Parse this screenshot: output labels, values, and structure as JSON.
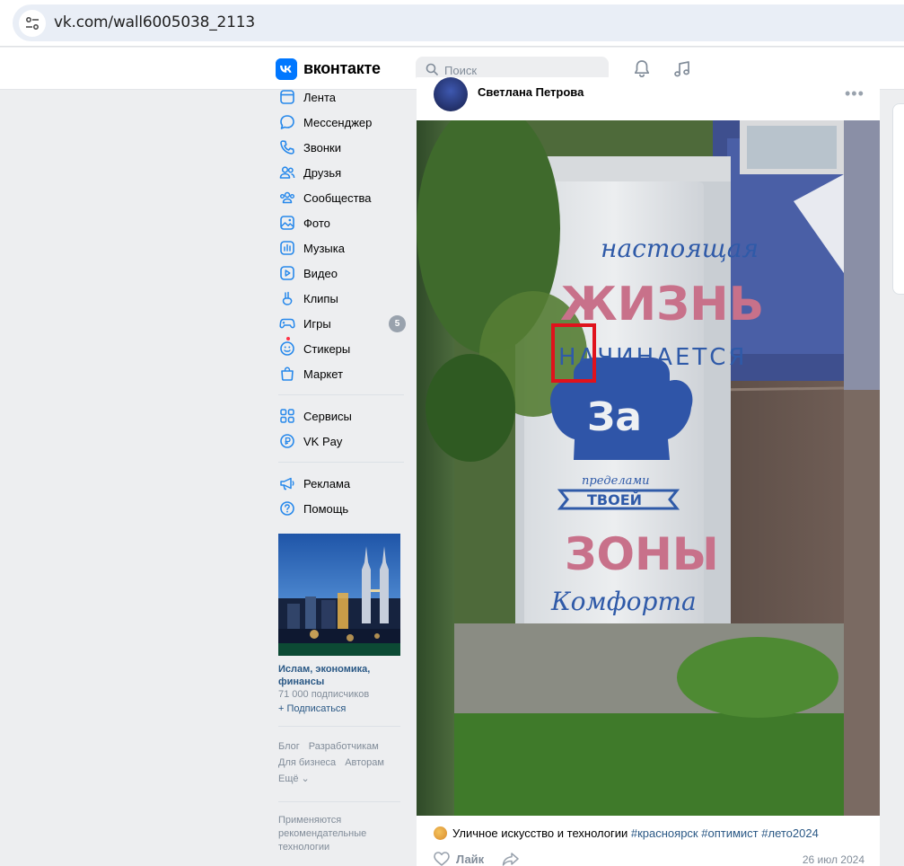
{
  "browser": {
    "url": "vk.com/wall6005038_2113"
  },
  "header": {
    "logo_letter": "К",
    "wordmark": "вконтакте",
    "search_placeholder": "Поиск"
  },
  "menu": {
    "items": [
      {
        "label": "Лента",
        "icon": "news-icon"
      },
      {
        "label": "Мессенджер",
        "icon": "messenger-icon"
      },
      {
        "label": "Звонки",
        "icon": "phone-icon"
      },
      {
        "label": "Друзья",
        "icon": "friends-icon"
      },
      {
        "label": "Сообщества",
        "icon": "communities-icon"
      },
      {
        "label": "Фото",
        "icon": "photo-icon"
      },
      {
        "label": "Музыка",
        "icon": "music-icon"
      },
      {
        "label": "Видео",
        "icon": "video-icon"
      },
      {
        "label": "Клипы",
        "icon": "clips-icon"
      },
      {
        "label": "Игры",
        "icon": "games-icon",
        "badge": "5"
      },
      {
        "label": "Стикеры",
        "icon": "stickers-icon"
      },
      {
        "label": "Маркет",
        "icon": "market-icon"
      }
    ],
    "services": [
      {
        "label": "Сервисы",
        "icon": "services-icon"
      },
      {
        "label": "VK Pay",
        "icon": "vkpay-icon"
      }
    ],
    "help": [
      {
        "label": "Реклама",
        "icon": "ads-icon"
      },
      {
        "label": "Помощь",
        "icon": "help-icon"
      }
    ]
  },
  "promo": {
    "title": "Ислам, экономика, финансы",
    "subscribers": "71 000 подписчиков",
    "subscribe": "+ Подписаться"
  },
  "footer": {
    "links": [
      "Блог",
      "Разработчикам",
      "Для бизнеса",
      "Авторам",
      "Ещё ⌄"
    ],
    "note": "Применяются рекомендательные технологии"
  },
  "post": {
    "author": "Светлана Петрова",
    "text": "Уличное искусство и технологии",
    "hashtags": [
      "#красноярск",
      "#оптимист",
      "#лето2024"
    ],
    "like_label": "Лайк",
    "date": "26 июл 2024",
    "photo_text": {
      "line1": "настоящая",
      "line2": "ЖИЗНЬ",
      "line3": "НАЧИНАЕТСЯ",
      "line4": "За",
      "line5": "пределами",
      "line6": "ТВОЕЙ",
      "line7": "ЗОНЫ",
      "line8": "Комфорта"
    }
  },
  "colors": {
    "accent": "#0077ff",
    "link": "#2a5885",
    "page_bg": "#edeef0",
    "highlight": "#e0121c"
  }
}
